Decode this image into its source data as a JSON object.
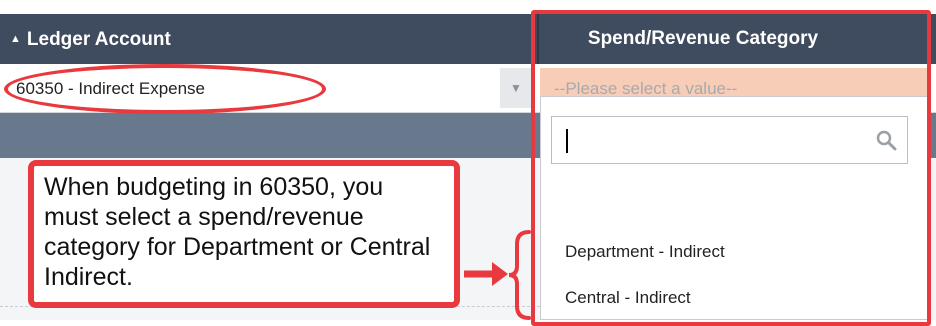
{
  "header": {
    "sort_icon": "▲",
    "ledger_account_label": "Ledger Account",
    "spend_revenue_label": "Spend/Revenue Category"
  },
  "row": {
    "ledger_value": "60350 - Indirect Expense",
    "ledger_dropdown_icon": "▼",
    "spend_revenue_placeholder": "--Please select a value--"
  },
  "dropdown": {
    "search_value": "",
    "options": [
      "Department - Indirect",
      "Central - Indirect"
    ]
  },
  "callout": {
    "text": "When budgeting in 60350, you must select a spend/revenue category for Department or Central Indirect."
  },
  "colors": {
    "header_bg": "#3f4b5e",
    "band_bg": "#68798d",
    "select_bg": "#f8cdb8",
    "highlight": "#e8393f"
  }
}
